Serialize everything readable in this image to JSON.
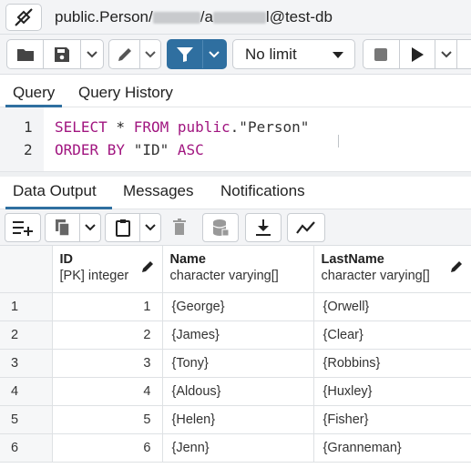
{
  "titlebar": {
    "connection_prefix": "public.Person/",
    "connection_mid": "/a",
    "connection_suffix": "l@test-db"
  },
  "toolbar": {
    "limit_value": "No limit"
  },
  "query_tabs": [
    {
      "label": "Query",
      "active": true
    },
    {
      "label": "Query History",
      "active": false
    }
  ],
  "editor": {
    "lines": [
      {
        "number": "1",
        "tokens": [
          {
            "text": "SELECT",
            "kind": "kw"
          },
          {
            "text": " * ",
            "kind": "plain"
          },
          {
            "text": "FROM",
            "kind": "kw"
          },
          {
            "text": " ",
            "kind": "plain"
          },
          {
            "text": "public",
            "kind": "kw"
          },
          {
            "text": ".\"Person\"",
            "kind": "str"
          }
        ]
      },
      {
        "number": "2",
        "tokens": [
          {
            "text": "ORDER BY",
            "kind": "kw"
          },
          {
            "text": " \"ID\" ",
            "kind": "str"
          },
          {
            "text": "ASC",
            "kind": "kw"
          }
        ]
      }
    ]
  },
  "output_tabs": [
    {
      "label": "Data Output",
      "active": true
    },
    {
      "label": "Messages",
      "active": false
    },
    {
      "label": "Notifications",
      "active": false
    }
  ],
  "grid": {
    "columns": [
      {
        "name": "ID",
        "type": "[PK] integer"
      },
      {
        "name": "Name",
        "type": "character varying[]"
      },
      {
        "name": "LastName",
        "type": "character varying[]"
      }
    ],
    "rows": [
      {
        "n": "1",
        "id": "1",
        "name": "{George}",
        "last": "{Orwell}"
      },
      {
        "n": "2",
        "id": "2",
        "name": "{James}",
        "last": "{Clear}"
      },
      {
        "n": "3",
        "id": "3",
        "name": "{Tony}",
        "last": "{Robbins}"
      },
      {
        "n": "4",
        "id": "4",
        "name": "{Aldous}",
        "last": "{Huxley}"
      },
      {
        "n": "5",
        "id": "5",
        "name": "{Helen}",
        "last": "{Fisher}"
      },
      {
        "n": "6",
        "id": "6",
        "name": "{Jenn}",
        "last": "{Granneman}"
      }
    ]
  },
  "colors": {
    "accent": "#2f6fa0",
    "keyword": "#a11680"
  }
}
